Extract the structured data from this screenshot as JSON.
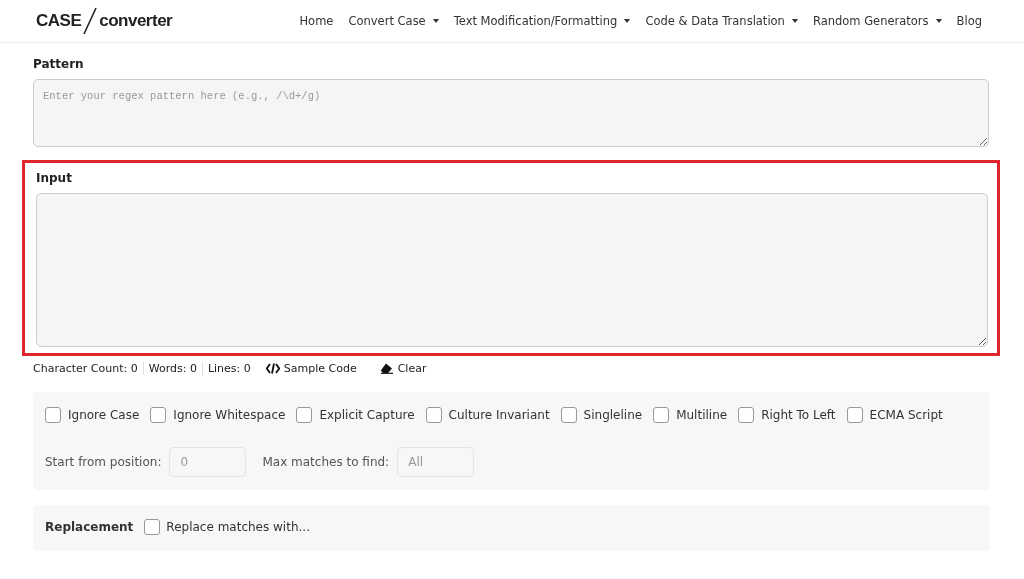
{
  "logo": {
    "left": "CASE",
    "right": "converter"
  },
  "nav": [
    {
      "label": "Home",
      "dropdown": false
    },
    {
      "label": "Convert Case",
      "dropdown": true
    },
    {
      "label": "Text Modification/Formatting",
      "dropdown": true
    },
    {
      "label": "Code & Data Translation",
      "dropdown": true
    },
    {
      "label": "Random Generators",
      "dropdown": true
    },
    {
      "label": "Blog",
      "dropdown": false
    }
  ],
  "pattern": {
    "label": "Pattern",
    "placeholder": "Enter your regex pattern here (e.g., /\\d+/g)"
  },
  "input": {
    "label": "Input",
    "highlighted": true
  },
  "stats": [
    {
      "label": "Character Count: 0"
    },
    {
      "label": "Words: 0"
    },
    {
      "label": "Lines: 0"
    }
  ],
  "actions": [
    {
      "kind": "code",
      "label": "Sample Code"
    },
    {
      "kind": "clear",
      "label": "Clear"
    }
  ],
  "options": [
    {
      "label": "Ignore Case",
      "checked": false
    },
    {
      "label": "Ignore Whitespace",
      "checked": false
    },
    {
      "label": "Explicit Capture",
      "checked": false
    },
    {
      "label": "Culture Invariant",
      "checked": false
    },
    {
      "label": "Singleline",
      "checked": false
    },
    {
      "label": "Multiline",
      "checked": false
    },
    {
      "label": "Right To Left",
      "checked": false
    },
    {
      "label": "ECMA Script",
      "checked": false
    }
  ],
  "start": {
    "label": "Start from position:",
    "placeholder": "0"
  },
  "max": {
    "label": "Max matches to find:",
    "placeholder": "All"
  },
  "replacement": {
    "label": "Replacement",
    "option": "Replace matches with...",
    "checked": false
  }
}
